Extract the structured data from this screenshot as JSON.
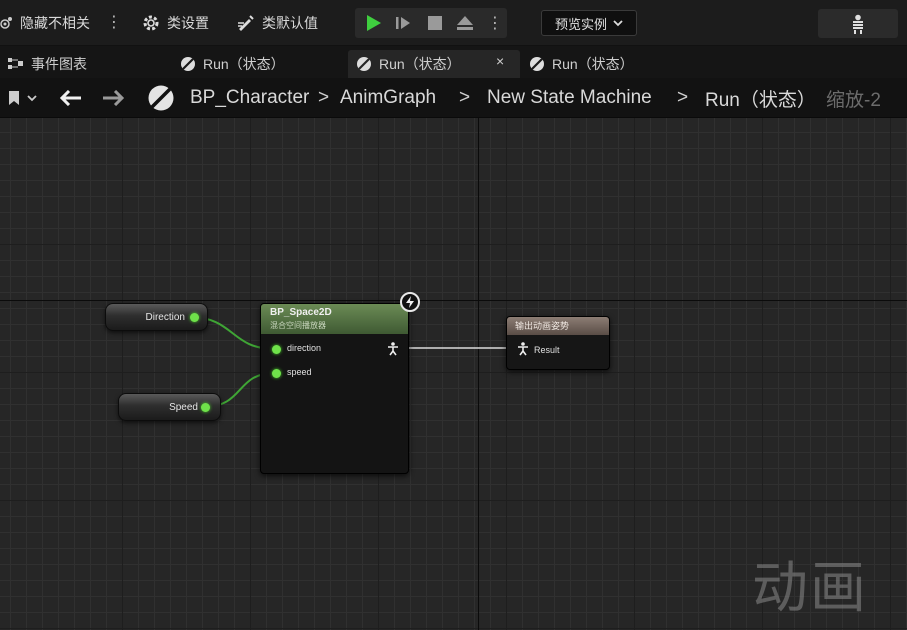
{
  "toolbar": {
    "hide_unrelated": "隐藏不相关",
    "class_settings": "类设置",
    "class_defaults": "类默认值",
    "preview_instance": "预览实例"
  },
  "tabs": [
    {
      "label": "事件图表"
    },
    {
      "label": "Run（状态）"
    },
    {
      "label": "Run（状态）"
    },
    {
      "label": "Run（状态）"
    }
  ],
  "tab_close": "×",
  "breadcrumb": {
    "items": [
      "BP_Character",
      "AnimGraph",
      "New State Machine",
      "Run（状态）"
    ],
    "separator": ">",
    "zoom": "缩放-2"
  },
  "graph": {
    "variables": [
      {
        "label": "Direction"
      },
      {
        "label": "Speed"
      }
    ],
    "blendspace_node": {
      "title": "BP_Space2D",
      "subtitle": "混合空间播放器",
      "pins": [
        "direction",
        "speed"
      ]
    },
    "output_node": {
      "title": "输出动画姿势",
      "pin": "Result"
    },
    "watermark": "动画"
  },
  "colors": {
    "exec_green": "#3fcf3f",
    "pin_green": "#6fe24a",
    "wire_green": "#3fa535",
    "node_header_green": "#5a7a48",
    "output_header": "#7a6b62"
  }
}
